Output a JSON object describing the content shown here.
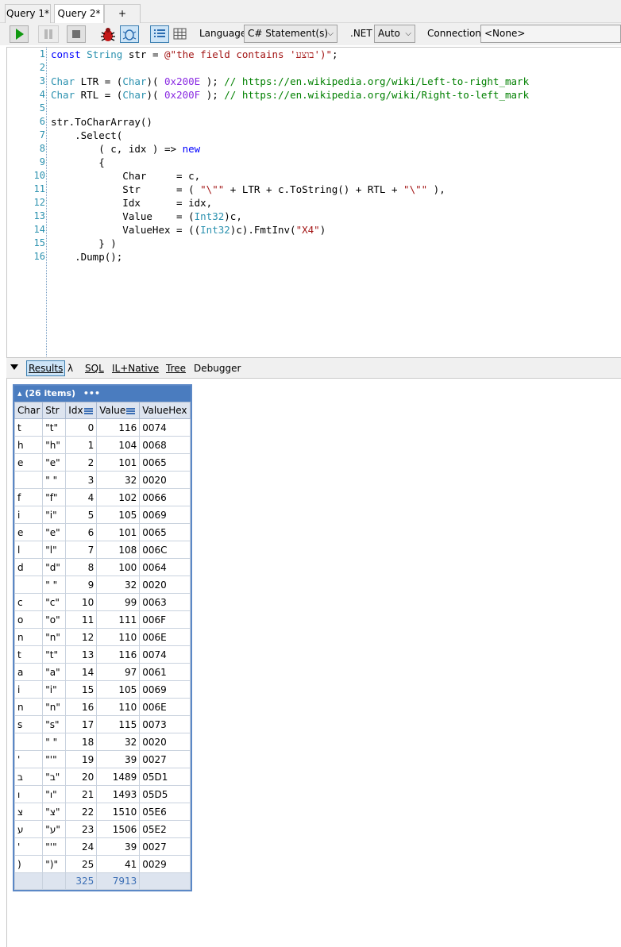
{
  "tabs": [
    {
      "label": "Query 1*"
    },
    {
      "label": "Query 2*"
    },
    {
      "label": "+"
    }
  ],
  "toolbar": {
    "language_label": "Language",
    "language_value": "C# Statement(s)",
    "dotnet_label": ".NET",
    "dotnet_value": "Auto",
    "connection_label": "Connection",
    "connection_value": "<None>"
  },
  "editor": {
    "line_numbers": [
      "1",
      "2",
      "3",
      "4",
      "5",
      "6",
      "7",
      "8",
      "9",
      "10",
      "11",
      "12",
      "13",
      "14",
      "15",
      "16"
    ]
  },
  "result_tabs": [
    "Results",
    "λ",
    "SQL",
    "IL+Native",
    "Tree",
    "Debugger"
  ],
  "grid": {
    "title": "▴ (26 items)",
    "menu": "•••",
    "columns": [
      "Char",
      "Str",
      "Idx",
      "Value",
      "ValueHex"
    ],
    "rows": [
      [
        "t",
        "\"t\"",
        "0",
        "116",
        "0074"
      ],
      [
        "h",
        "\"h\"",
        "1",
        "104",
        "0068"
      ],
      [
        "e",
        "\"e\"",
        "2",
        "101",
        "0065"
      ],
      [
        " ",
        "\" \"",
        "3",
        "32",
        "0020"
      ],
      [
        "f",
        "\"f\"",
        "4",
        "102",
        "0066"
      ],
      [
        "i",
        "\"i\"",
        "5",
        "105",
        "0069"
      ],
      [
        "e",
        "\"e\"",
        "6",
        "101",
        "0065"
      ],
      [
        "l",
        "\"l\"",
        "7",
        "108",
        "006C"
      ],
      [
        "d",
        "\"d\"",
        "8",
        "100",
        "0064"
      ],
      [
        " ",
        "\" \"",
        "9",
        "32",
        "0020"
      ],
      [
        "c",
        "\"c\"",
        "10",
        "99",
        "0063"
      ],
      [
        "o",
        "\"o\"",
        "11",
        "111",
        "006F"
      ],
      [
        "n",
        "\"n\"",
        "12",
        "110",
        "006E"
      ],
      [
        "t",
        "\"t\"",
        "13",
        "116",
        "0074"
      ],
      [
        "a",
        "\"a\"",
        "14",
        "97",
        "0061"
      ],
      [
        "i",
        "\"i\"",
        "15",
        "105",
        "0069"
      ],
      [
        "n",
        "\"n\"",
        "16",
        "110",
        "006E"
      ],
      [
        "s",
        "\"s\"",
        "17",
        "115",
        "0073"
      ],
      [
        " ",
        "\" \"",
        "18",
        "32",
        "0020"
      ],
      [
        "'",
        "\"'\"",
        "19",
        "39",
        "0027"
      ],
      [
        "ב",
        "\"ב\"",
        "20",
        "1489",
        "05D1"
      ],
      [
        "ו",
        "\"ו\"",
        "21",
        "1493",
        "05D5"
      ],
      [
        "צ",
        "\"צ\"",
        "22",
        "1510",
        "05E6"
      ],
      [
        "ע",
        "\"ע\"",
        "23",
        "1506",
        "05E2"
      ],
      [
        "'",
        "\"'\"",
        "24",
        "39",
        "0027"
      ],
      [
        ")",
        "\")\"",
        "25",
        "41",
        "0029"
      ]
    ],
    "totals": [
      "",
      "",
      "325",
      "7913",
      ""
    ]
  },
  "colors": {
    "keyword": "#0000ff",
    "type": "#2b91af",
    "string": "#a31515",
    "comment": "#008000",
    "number": "#8a2be2",
    "grid_header": "#4a7cbf"
  }
}
